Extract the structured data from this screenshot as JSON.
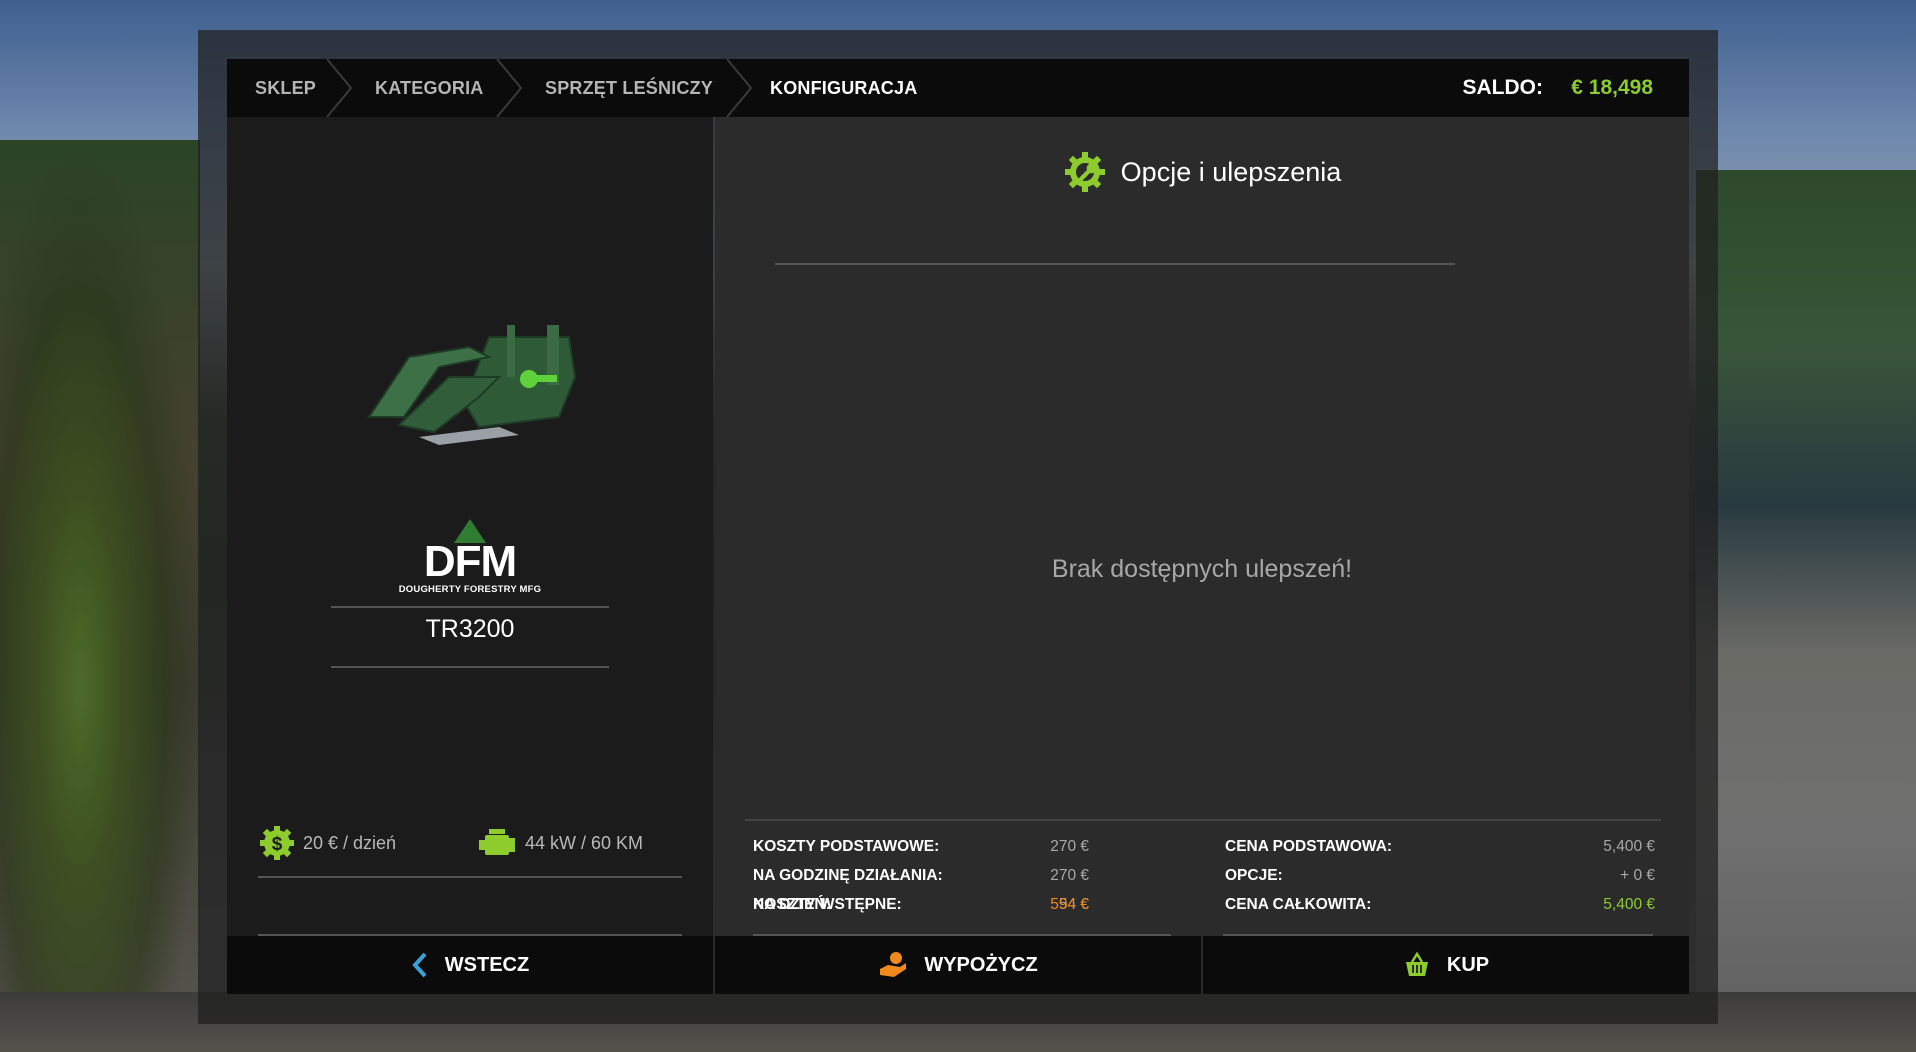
{
  "breadcrumb": {
    "items": [
      "SKLEP",
      "KATEGORIA",
      "SPRZĘT LEŚNICZY",
      "KONFIGURACJA"
    ]
  },
  "balance": {
    "label": "SALDO:",
    "value": "€ 18,498"
  },
  "product": {
    "brand_logo_text": "DFM",
    "brand_name": "DOUGHERTY FORESTRY MFG",
    "model": "TR3200",
    "daily_cost": "20 € / dzień",
    "power": "44 kW / 60 KM"
  },
  "options": {
    "title": "Opcje i ulepszenia",
    "empty_message": "Brak dostępnych ulepszeń!"
  },
  "costs": {
    "left": [
      {
        "label": "KOSZTY PODSTAWOWE:",
        "value": "270 €"
      },
      {
        "label": "NA GODZINĘ DZIAŁANIA:",
        "value": "270 €"
      },
      {
        "label": "NA DZIEŃ:",
        "value": "54 €"
      }
    ],
    "left_total": {
      "label": "KOSZTY WSTĘPNE:",
      "value": "594 €"
    },
    "right": [
      {
        "label": "CENA PODSTAWOWA:",
        "value": "5,400 €"
      },
      {
        "label": "OPCJE:",
        "value": "+ 0 €"
      }
    ],
    "right_total": {
      "label": "CENA CAŁKOWITA:",
      "value": "5,400 €"
    }
  },
  "buttons": {
    "back": "WSTECZ",
    "lease": "WYPOŻYCZ",
    "buy": "KUP"
  },
  "colors": {
    "accent_green": "#8dcc2c",
    "accent_orange": "#f08a1c",
    "accent_blue": "#3aa0d8"
  },
  "icons": {
    "options": "gear-wrench-icon",
    "daily_cost": "dollar-gear-icon",
    "power": "engine-icon",
    "back": "chevron-left-icon",
    "lease": "hand-coin-icon",
    "buy": "basket-icon"
  }
}
